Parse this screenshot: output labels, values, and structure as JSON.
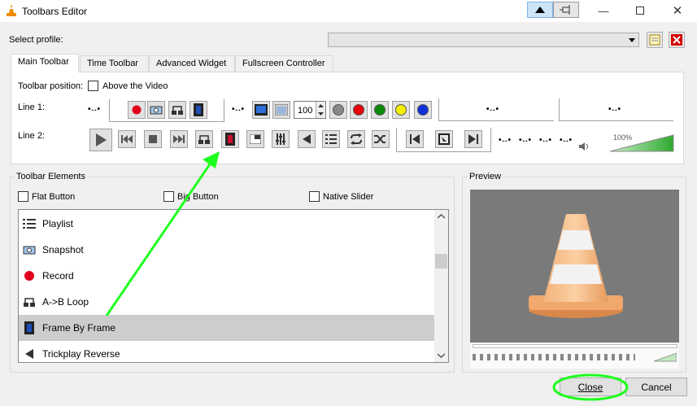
{
  "window": {
    "title": "Toolbars Editor"
  },
  "profile": {
    "label": "Select profile:",
    "value": ""
  },
  "tabs": [
    {
      "label": "Main Toolbar"
    },
    {
      "label": "Time Toolbar"
    },
    {
      "label": "Advanced Widget"
    },
    {
      "label": "Fullscreen Controller"
    }
  ],
  "main_toolbar": {
    "position_label": "Toolbar position:",
    "above_video_label": "Above the Video",
    "line1_label": "Line 1:",
    "line2_label": "Line 2:",
    "spin_value": "100",
    "volume_percent": "100%",
    "volume_level": 1.0,
    "spacer_glyph": "•↔•"
  },
  "elements": {
    "title": "Toolbar Elements",
    "flat_button": "Flat Button",
    "big_button": "Big Button",
    "native_slider": "Native Slider",
    "items": [
      {
        "label": "Playlist",
        "icon": "playlist-icon"
      },
      {
        "label": "Snapshot",
        "icon": "snapshot-icon"
      },
      {
        "label": "Record",
        "icon": "record-icon"
      },
      {
        "label": "A->B Loop",
        "icon": "ab-loop-icon"
      },
      {
        "label": "Frame By Frame",
        "icon": "frame-by-frame-icon",
        "selected": true
      },
      {
        "label": "Trickplay Reverse",
        "icon": "trickplay-reverse-icon"
      }
    ]
  },
  "preview": {
    "title": "Preview"
  },
  "buttons": {
    "close": "Close",
    "cancel": "Cancel"
  },
  "colors": {
    "annotation": "#1eff1e",
    "record": "#e0001b",
    "volume": "#2ea82e"
  }
}
